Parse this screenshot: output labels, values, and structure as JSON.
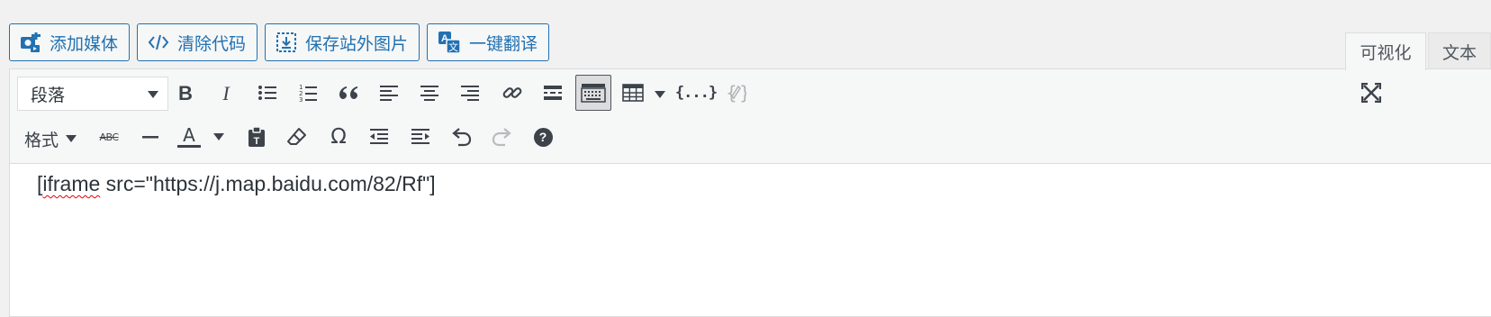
{
  "media_buttons": [
    {
      "label": "添加媒体",
      "icon": "add-media-icon"
    },
    {
      "label": "清除代码",
      "icon": "code-icon"
    },
    {
      "label": "保存站外图片",
      "icon": "download-image-icon"
    },
    {
      "label": "一键翻译",
      "icon": "translate-icon"
    }
  ],
  "tabs": {
    "visual": "可视化",
    "text": "文本"
  },
  "toolbar": {
    "format_select": "段落",
    "formats_menu": "格式",
    "row1_icons": [
      "bold-icon",
      "italic-icon",
      "bullet-list-icon",
      "numbered-list-icon",
      "blockquote-icon",
      "align-left-icon",
      "align-center-icon",
      "align-right-icon",
      "link-icon",
      "read-more-icon",
      "toolbar-toggle-icon",
      "table-icon",
      "code-braces-icon",
      "remove-code-icon",
      "fullscreen-icon"
    ],
    "row2_icons": [
      "strikethrough-icon",
      "horizontal-line-icon",
      "text-color-icon",
      "paste-text-icon",
      "clear-formatting-icon",
      "special-character-icon",
      "outdent-icon",
      "indent-icon",
      "undo-icon",
      "redo-icon",
      "help-icon"
    ],
    "strike_text": "ABC",
    "text_color_letter": "A",
    "omega": "Ω",
    "help": "?",
    "braces": "{...}",
    "active_button": "toolbar-toggle"
  },
  "content": {
    "prefix": "[",
    "misspelled": "iframe",
    "rest": " src=\"https://j.map.baidu.com/82/Rf\"]"
  },
  "colors": {
    "accent": "#2271b1",
    "spellcheck": "#e00000",
    "toolbar_bg": "#f6f7f7"
  }
}
